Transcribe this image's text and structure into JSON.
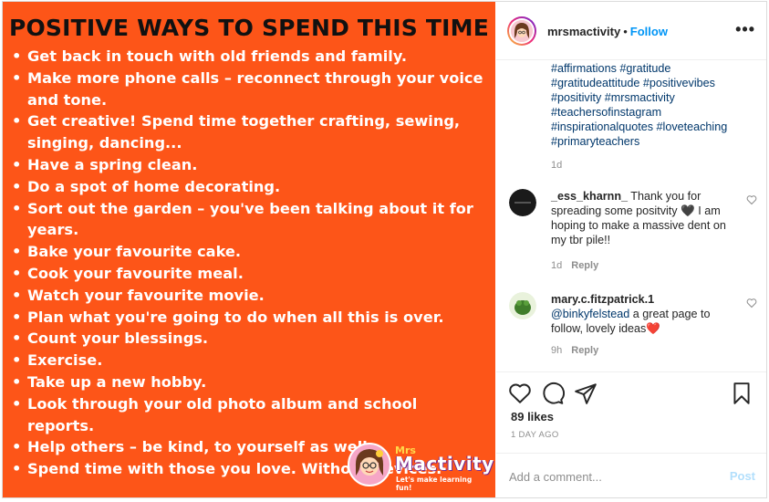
{
  "image": {
    "title": "POSITIVE WAYS TO SPEND THIS TIME",
    "items": [
      "Get back in touch with old friends and family.",
      "Make more phone calls – reconnect through your voice and tone.",
      "Get creative! Spend time together crafting, sewing, singing, dancing...",
      "Have a spring clean.",
      "Do a spot of home decorating.",
      "Sort out the garden – you've been talking about it for years.",
      "Bake your favourite cake.",
      "Cook your favourite meal.",
      "Watch your favourite movie.",
      "Plan what you're going to do when all this is over.",
      "Count your blessings.",
      "Exercise.",
      "Take up a new hobby.",
      "Look through your old photo album and school reports.",
      "Help others – be kind, to yourself as well.",
      "Spend time with those you love. Without devices."
    ],
    "logo": {
      "mrs": "Mrs",
      "name": "Mactivity",
      "tagline": "Let's make learning fun!"
    },
    "background_color": "#fd5518"
  },
  "header": {
    "username": "mrsmactivity",
    "separator": "•",
    "follow_label": "Follow",
    "more_icon": "more-options-icon"
  },
  "caption": {
    "hashtags": "#affirmations #gratitude #gratitudeattitude #positivevibes #positivity #mrsmactivity #teachersofinstagram #inspirationalquotes #loveteaching #primaryteachers",
    "time": "1d"
  },
  "comments": [
    {
      "user": "_ess_kharnn_",
      "text": "Thank you for spreading some positvity 🖤 I am hoping to make a massive dent on my tbr pile!!",
      "time": "1d",
      "reply_label": "Reply"
    },
    {
      "user": "mary.c.fitzpatrick.1",
      "mention": "@binkyfelstead",
      "text": "a great page to follow, lovely ideas❤️",
      "time": "9h",
      "reply_label": "Reply"
    }
  ],
  "actions": {
    "likes": "89 likes",
    "posted": "1 DAY AGO"
  },
  "add_comment": {
    "placeholder": "Add a comment...",
    "post_label": "Post"
  },
  "colors": {
    "accent": "#0095f6",
    "hashtag": "#00376b",
    "muted": "#8e8e8e"
  }
}
